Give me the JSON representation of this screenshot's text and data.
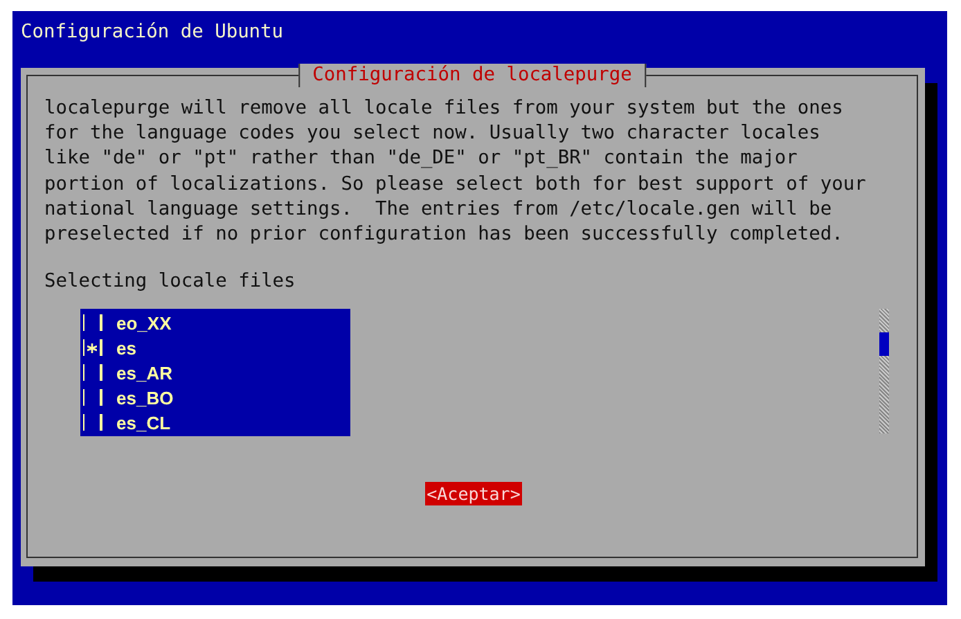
{
  "screen": {
    "title": "Configuración de Ubuntu"
  },
  "dialog": {
    "title": "Configuración de localepurge",
    "message": "localepurge will remove all locale files from your system but the ones\nfor the language codes you select now. Usually two character locales\nlike \"de\" or \"pt\" rather than \"de_DE\" or \"pt_BR\" contain the major\nportion of localizations. So please select both for best support of your\nnational language settings.  The entries from /etc/locale.gen will be\npreselected if no prior configuration has been successfully completed.",
    "prompt": "Selecting locale files",
    "items": [
      {
        "label": "eo_XX",
        "checked": false
      },
      {
        "label": "es",
        "checked": true
      },
      {
        "label": "es_AR",
        "checked": false
      },
      {
        "label": "es_BO",
        "checked": false
      },
      {
        "label": "es_CL",
        "checked": false
      }
    ],
    "buttons": [
      {
        "label": "<Aceptar>",
        "selected": true
      }
    ]
  }
}
